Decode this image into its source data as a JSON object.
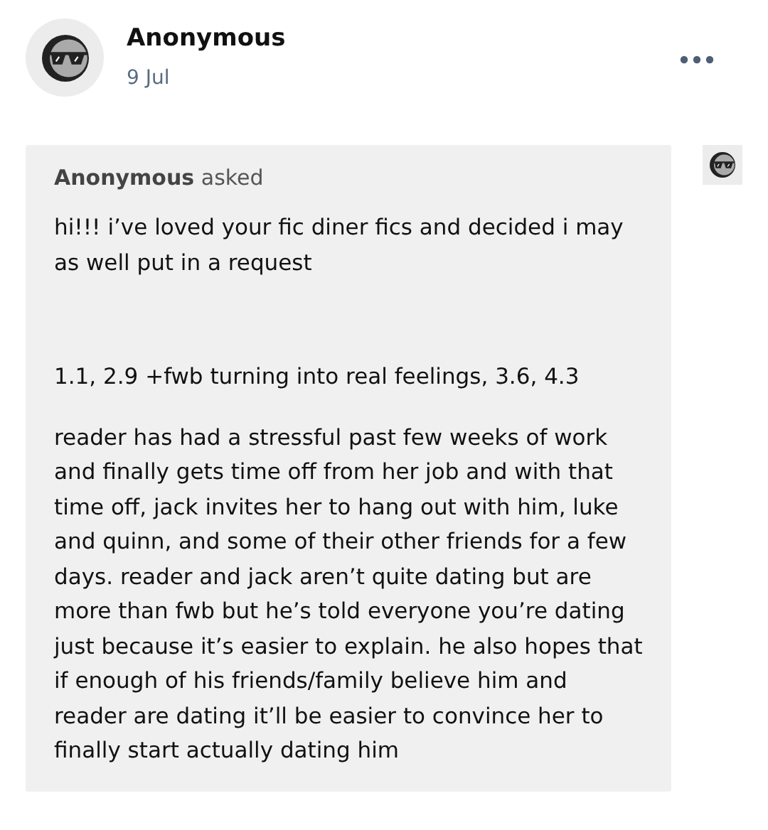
{
  "post": {
    "author": "Anonymous",
    "date": "9 Jul"
  },
  "ask": {
    "asker": "Anonymous",
    "verb": "asked",
    "paragraphs": [
      "hi!!! i’ve loved your fic diner fics and decided i may as well put in a request",
      "1.1, 2.9 +fwb turning into real feelings, 3.6, 4.3",
      "reader has had a stressful past few weeks of work and finally gets time off from her job and with that time off, jack invites her to hang out with him, luke and quinn, and some of their other friends for a few days. reader and jack aren’t quite dating but are more than fwb but he’s told everyone you’re dating just because it’s easier to explain. he also hopes that if enough of his friends/family believe him and reader are dating it’ll be easier to convince her to finally start actually dating him"
    ]
  }
}
